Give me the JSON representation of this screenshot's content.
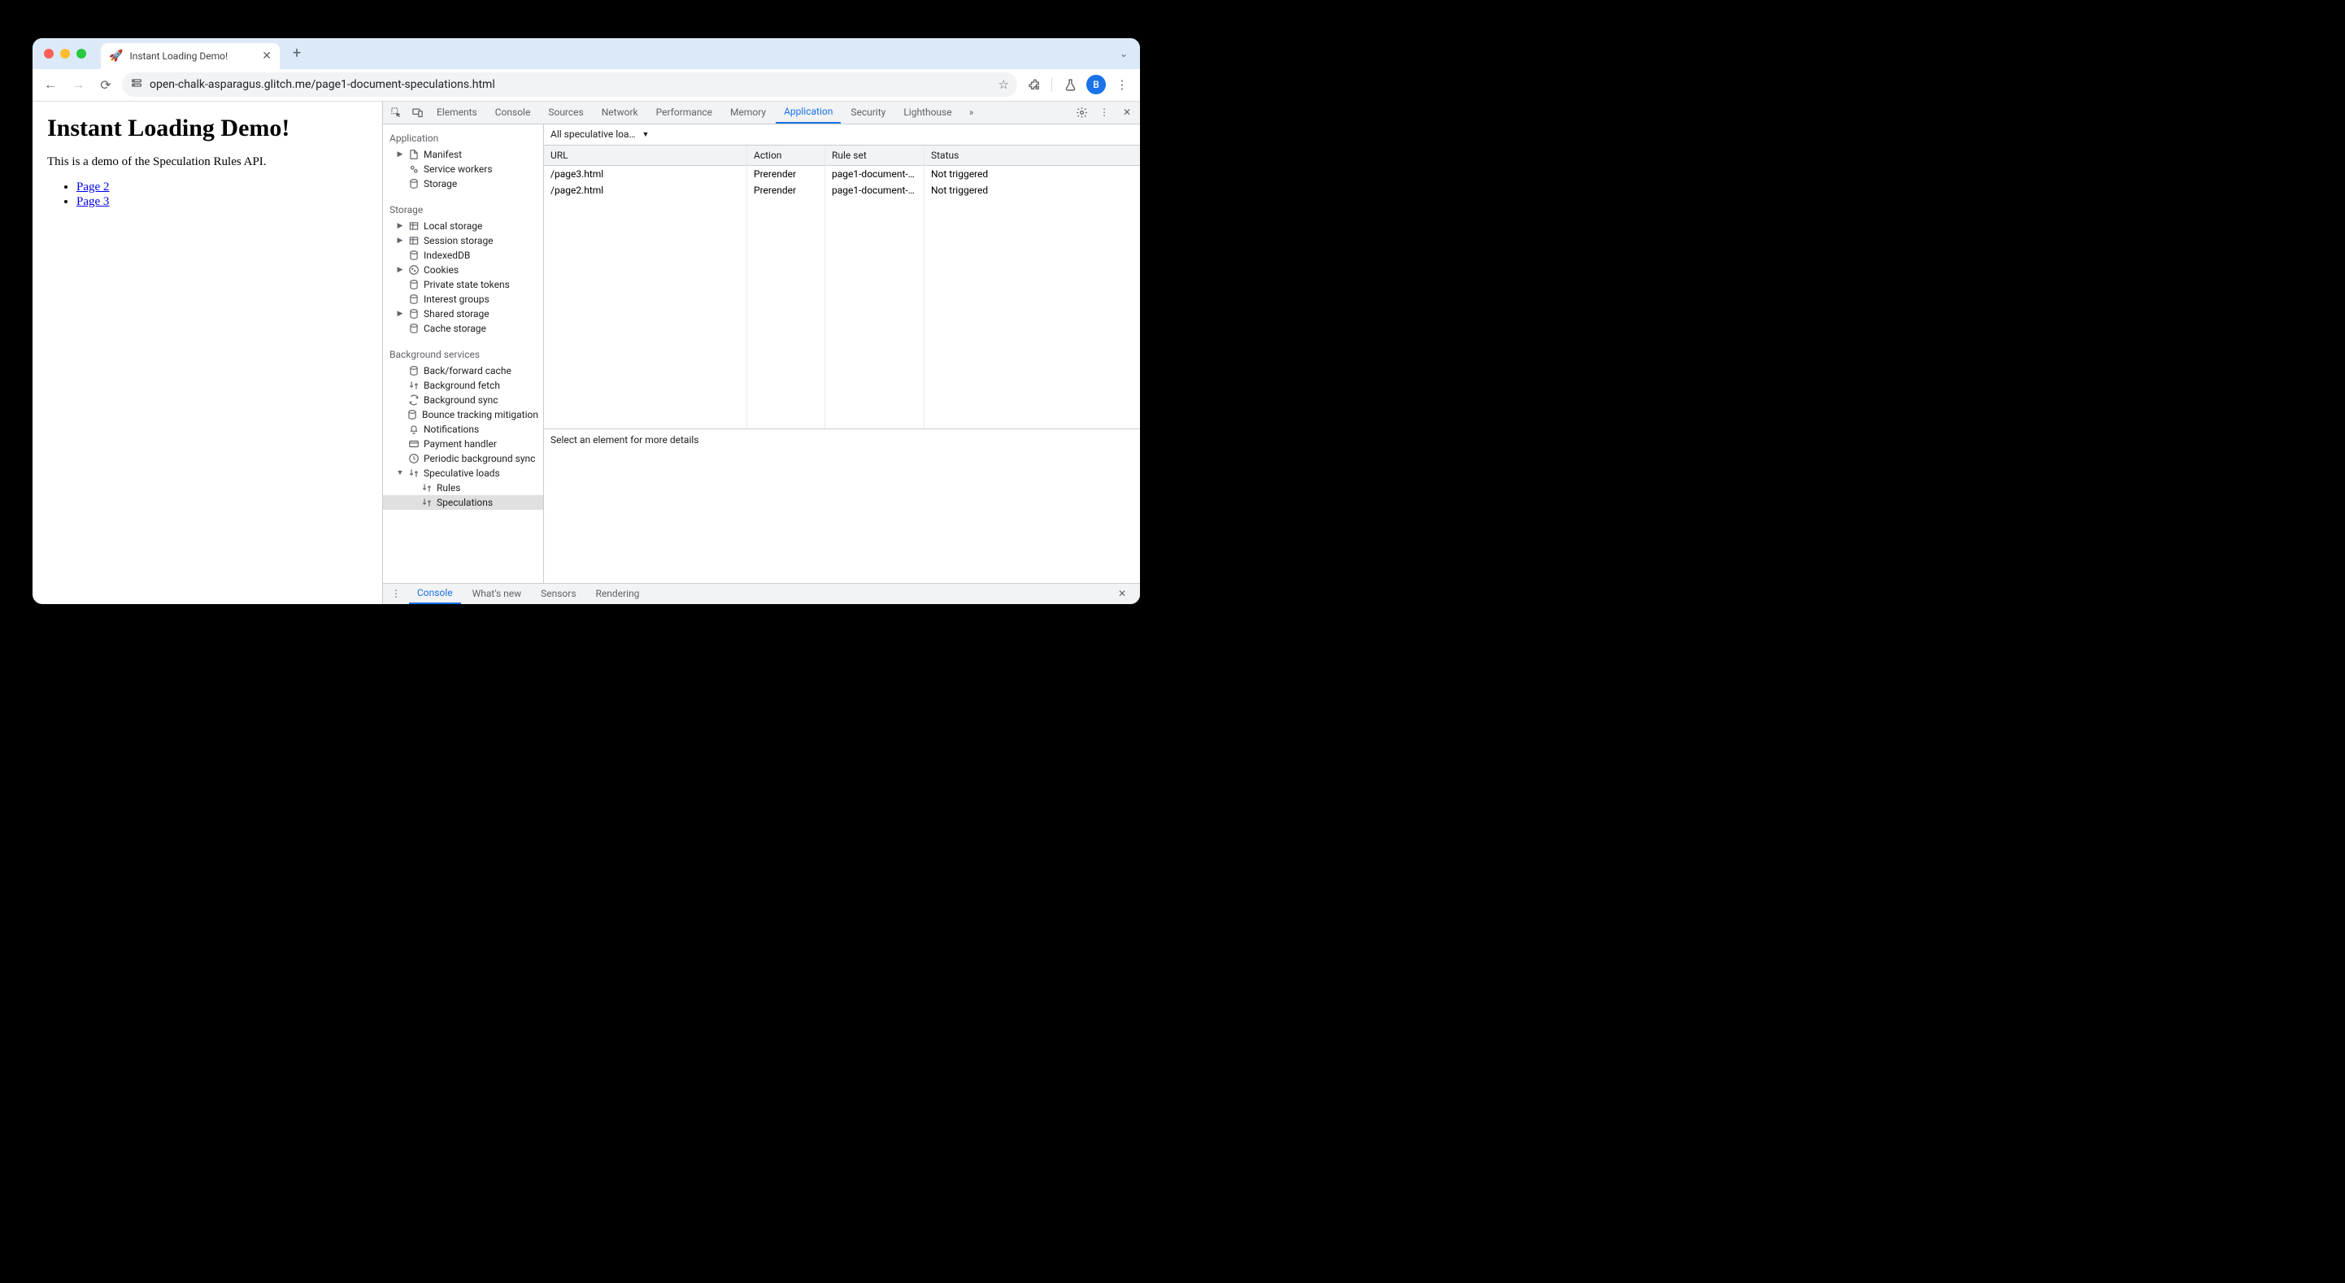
{
  "tab": {
    "favicon": "🚀",
    "title": "Instant Loading Demo!"
  },
  "url": "open-chalk-asparagus.glitch.me/page1-document-speculations.html",
  "avatar_letter": "B",
  "page": {
    "heading": "Instant Loading Demo!",
    "intro": "This is a demo of the Speculation Rules API.",
    "links": [
      "Page 2",
      "Page 3"
    ]
  },
  "devtools": {
    "tabs": [
      "Elements",
      "Console",
      "Sources",
      "Network",
      "Performance",
      "Memory",
      "Application",
      "Security",
      "Lighthouse"
    ],
    "active_tab": "Application",
    "sections": {
      "application": {
        "header": "Application",
        "items": [
          "Manifest",
          "Service workers",
          "Storage"
        ]
      },
      "storage": {
        "header": "Storage",
        "items": [
          "Local storage",
          "Session storage",
          "IndexedDB",
          "Cookies",
          "Private state tokens",
          "Interest groups",
          "Shared storage",
          "Cache storage"
        ]
      },
      "background": {
        "header": "Background services",
        "items": [
          "Back/forward cache",
          "Background fetch",
          "Background sync",
          "Bounce tracking mitigation",
          "Notifications",
          "Payment handler",
          "Periodic background sync",
          "Speculative loads"
        ],
        "speculative_children": [
          "Rules",
          "Speculations"
        ]
      }
    },
    "filter_label": "All speculative loa…",
    "table": {
      "headers": [
        "URL",
        "Action",
        "Rule set",
        "Status"
      ],
      "rows": [
        {
          "url": "/page3.html",
          "action": "Prerender",
          "ruleset": "page1-document-…",
          "status": "Not triggered"
        },
        {
          "url": "/page2.html",
          "action": "Prerender",
          "ruleset": "page1-document-…",
          "status": "Not triggered"
        }
      ]
    },
    "detail_placeholder": "Select an element for more details",
    "drawer_tabs": [
      "Console",
      "What's new",
      "Sensors",
      "Rendering"
    ],
    "drawer_active": "Console"
  }
}
